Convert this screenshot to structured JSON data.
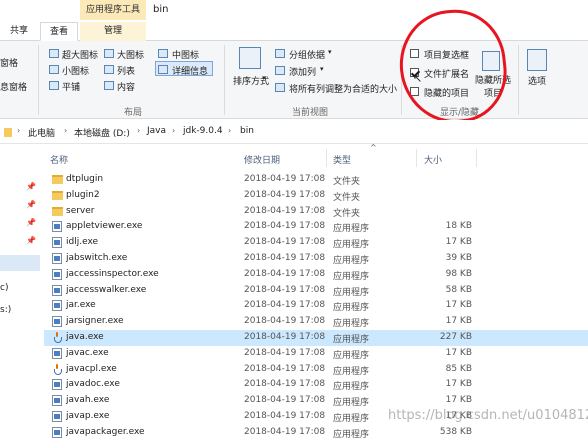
{
  "titlebar": {
    "context_tab": "应用程序工具",
    "window_title": "bin"
  },
  "tabs": [
    {
      "label": "共享"
    },
    {
      "label": "查看"
    },
    {
      "label": "管理"
    }
  ],
  "ribbon": {
    "left_clipped": [
      "窗格",
      "息窗格"
    ],
    "layout": {
      "items": [
        "超大图标",
        "大图标",
        "中图标",
        "小图标",
        "列表",
        "详细信息",
        "平铺",
        "内容"
      ],
      "selected": "详细信息",
      "group_label": "布局"
    },
    "current_view": {
      "sort_label": "排序方式",
      "group_by": "分组依据",
      "add_column": "添加列",
      "fit_columns": "将所有列调整为合适的大小",
      "group_label": "当前视图"
    },
    "show_hide": {
      "item_checkboxes": {
        "label": "项目复选框",
        "checked": false
      },
      "file_extensions": {
        "label": "文件扩展名",
        "checked": true
      },
      "hidden_items": {
        "label": "隐藏的项目",
        "checked": false
      },
      "hide_selected": "隐藏所选项目",
      "options": "选项",
      "group_label": "显示/隐藏"
    }
  },
  "address": {
    "crumbs": [
      "此电脑",
      "本地磁盘 (D:)",
      "Java",
      "jdk-9.0.4",
      "bin"
    ]
  },
  "nav": {
    "clipped_labels": [
      "c)",
      "s:)"
    ]
  },
  "columns": {
    "name": "名称",
    "date": "修改日期",
    "type": "类型",
    "size": "大小"
  },
  "files": [
    {
      "name": "dtplugin",
      "date": "2018-04-19 17:08",
      "type": "文件夹",
      "size": "",
      "kind": "folder"
    },
    {
      "name": "plugin2",
      "date": "2018-04-19 17:08",
      "type": "文件夹",
      "size": "",
      "kind": "folder"
    },
    {
      "name": "server",
      "date": "2018-04-19 17:08",
      "type": "文件夹",
      "size": "",
      "kind": "folder"
    },
    {
      "name": "appletviewer.exe",
      "date": "2018-04-19 17:08",
      "type": "应用程序",
      "size": "18 KB",
      "kind": "exe"
    },
    {
      "name": "idlj.exe",
      "date": "2018-04-19 17:08",
      "type": "应用程序",
      "size": "17 KB",
      "kind": "exe"
    },
    {
      "name": "jabswitch.exe",
      "date": "2018-04-19 17:08",
      "type": "应用程序",
      "size": "39 KB",
      "kind": "exe"
    },
    {
      "name": "jaccessinspector.exe",
      "date": "2018-04-19 17:08",
      "type": "应用程序",
      "size": "98 KB",
      "kind": "exe"
    },
    {
      "name": "jaccesswalker.exe",
      "date": "2018-04-19 17:08",
      "type": "应用程序",
      "size": "58 KB",
      "kind": "exe"
    },
    {
      "name": "jar.exe",
      "date": "2018-04-19 17:08",
      "type": "应用程序",
      "size": "17 KB",
      "kind": "exe"
    },
    {
      "name": "jarsigner.exe",
      "date": "2018-04-19 17:08",
      "type": "应用程序",
      "size": "17 KB",
      "kind": "exe"
    },
    {
      "name": "java.exe",
      "date": "2018-04-19 17:08",
      "type": "应用程序",
      "size": "227 KB",
      "kind": "java",
      "selected": true
    },
    {
      "name": "javac.exe",
      "date": "2018-04-19 17:08",
      "type": "应用程序",
      "size": "17 KB",
      "kind": "exe"
    },
    {
      "name": "javacpl.exe",
      "date": "2018-04-19 17:08",
      "type": "应用程序",
      "size": "85 KB",
      "kind": "java"
    },
    {
      "name": "javadoc.exe",
      "date": "2018-04-19 17:08",
      "type": "应用程序",
      "size": "17 KB",
      "kind": "exe"
    },
    {
      "name": "javah.exe",
      "date": "2018-04-19 17:08",
      "type": "应用程序",
      "size": "17 KB",
      "kind": "exe"
    },
    {
      "name": "javap.exe",
      "date": "2018-04-19 17:08",
      "type": "应用程序",
      "size": "17 KB",
      "kind": "exe"
    },
    {
      "name": "javapackager.exe",
      "date": "2018-04-19 17:08",
      "type": "应用程序",
      "size": "538 KB",
      "kind": "exe"
    }
  ],
  "watermark": "https://blog.csdn.net/u010481276",
  "colors": {
    "annotation": "#e8141f",
    "selection": "#cce8ff",
    "context_tab": "#fce9b8"
  }
}
